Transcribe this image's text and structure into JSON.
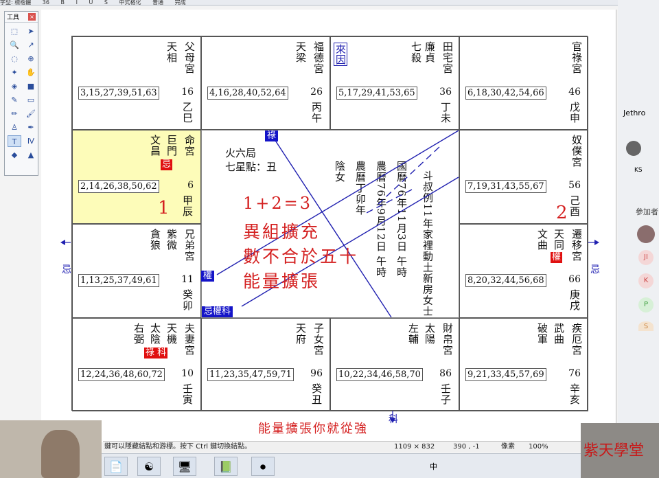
{
  "menu": {
    "items": [
      "字型: 標楷體",
      "36",
      "B",
      "I",
      "U",
      "S",
      "中式格化",
      "普通",
      "完成"
    ]
  },
  "toolbox": {
    "title": "工具",
    "close": "×"
  },
  "chart": {
    "palaces": [
      {
        "id": "fumu",
        "name": "父母宮",
        "stars": [
          "天相"
        ],
        "nums": "3,15,27,39,51,63",
        "num": "16",
        "stem": "乙巳"
      },
      {
        "id": "fude",
        "name": "福德宮",
        "stars": [
          "天梁"
        ],
        "nums": "4,16,28,40,52,64",
        "num": "26",
        "stem": "丙午"
      },
      {
        "id": "tianzhai",
        "name": "田宅宮",
        "stars": [
          "廉貞",
          "七殺"
        ],
        "nums": "5,17,29,41,53,65",
        "num": "36",
        "stem": "丁未",
        "tag": "來因"
      },
      {
        "id": "guanlu",
        "name": "官祿宮",
        "stars": [],
        "nums": "6,18,30,42,54,66",
        "num": "46",
        "stem": "戊申"
      },
      {
        "id": "ming",
        "name": "命宮",
        "stars": [
          "巨門",
          "文昌"
        ],
        "nums": "2,14,26,38,50,62",
        "num": "6",
        "stem": "甲辰",
        "badge": "忌",
        "mark": "1"
      },
      {
        "id": "nupu",
        "name": "奴僕宮",
        "stars": [],
        "nums": "7,19,31,43,55,67",
        "num": "56",
        "stem": "己酉"
      },
      {
        "id": "xiongdi",
        "name": "兄弟宮",
        "stars": [
          "紫微",
          "貪狼"
        ],
        "nums": "1,13,25,37,49,61",
        "num": "11",
        "stem": "癸卯"
      },
      {
        "id": "qianyi",
        "name": "遷移宮",
        "stars": [
          "天同",
          "文曲"
        ],
        "nums": "8,20,32,44,56,68",
        "num": "66",
        "stem": "庚戌",
        "badge": "權",
        "mark": "2"
      },
      {
        "id": "fuqi",
        "name": "夫妻宮",
        "stars": [
          "天機",
          "太陰",
          "右弼"
        ],
        "nums": "12,24,36,48,60,72",
        "num": "10",
        "stem": "壬寅",
        "badge": "祿 科"
      },
      {
        "id": "zinv",
        "name": "子女宮",
        "stars": [
          "天府"
        ],
        "nums": "11,23,35,47,59,71",
        "num": "96",
        "stem": "癸丑"
      },
      {
        "id": "caibo",
        "name": "財帛宮",
        "stars": [
          "太陽",
          "左輔"
        ],
        "nums": "10,22,34,46,58,70",
        "num": "86",
        "stem": "壬子"
      },
      {
        "id": "jie",
        "name": "疾厄宮",
        "stars": [
          "武曲",
          "破軍"
        ],
        "nums": "9,21,33,45,57,69",
        "num": "76",
        "stem": "辛亥"
      }
    ],
    "center": {
      "line1": "火六局",
      "line2": "七星點：丑",
      "cols": [
        "陰女",
        "農曆丁卯年",
        "農曆76年9月12日 午時",
        "國曆76年11月3日 午時",
        "斗叔例11年家裡動土新房女士"
      ]
    },
    "tags": {
      "lu": "祿",
      "quan": "權",
      "jqk": "忌權科"
    },
    "handwriting": {
      "l1": "1+2=3",
      "l2": "異組擴充",
      "l3": "數不合於五十",
      "l4": "能量擴張",
      "bottom": "能量擴張你就從強"
    },
    "side": {
      "left": "忌",
      "right": "忌",
      "bottom": "科"
    }
  },
  "status": {
    "hint": "鍵可以隱藏結點和游標。按下 Ctrl 鍵切換結點。",
    "size": "1109 × 832",
    "pos": "390 , -1",
    "unit": "像素",
    "zoom": "100%"
  },
  "right": {
    "label1": "Jethro",
    "label2": "KS",
    "label3": "參加者",
    "p": [
      "JI",
      "K",
      "P",
      "S"
    ]
  },
  "logo": "紫天學堂"
}
